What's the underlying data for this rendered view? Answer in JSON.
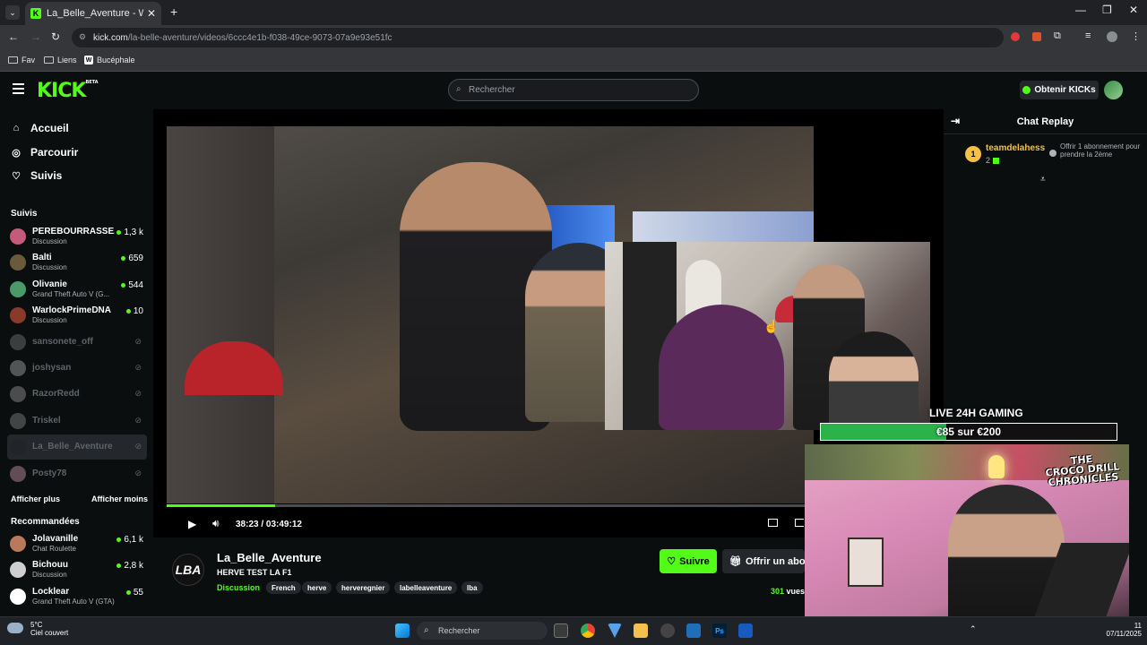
{
  "browser": {
    "tab_title": "La_Belle_Aventure - Watch the V",
    "url_host": "kick.com",
    "url_path": "/la-belle-aventure/videos/6ccc4e1b-f038-49ce-9073-07a9e93e51fc",
    "bookmarks": [
      "Fav",
      "Liens",
      "Bucéphale"
    ]
  },
  "header": {
    "logo": "KICK",
    "logo_badge": "BETA",
    "search_placeholder": "Rechercher",
    "get_kicks": "Obtenir KICKs"
  },
  "sidebar": {
    "nav": [
      {
        "label": "Accueil",
        "icon": "home-icon"
      },
      {
        "label": "Parcourir",
        "icon": "compass-icon"
      },
      {
        "label": "Suivis",
        "icon": "heart-icon"
      }
    ],
    "followed_title": "Suivis",
    "followed": [
      {
        "name": "PEREBOURRASSE...",
        "category": "Discussion",
        "viewers": "1,3 k",
        "live": true,
        "color": "#c65a7a"
      },
      {
        "name": "Balti",
        "category": "Discussion",
        "viewers": "659",
        "live": true,
        "color": "#6b5a3a"
      },
      {
        "name": "Olivanie",
        "category": "Grand Theft Auto V (G...",
        "viewers": "544",
        "live": true,
        "color": "#4a9a6a"
      },
      {
        "name": "WarlockPrimeDNA",
        "category": "Discussion",
        "viewers": "10",
        "live": true,
        "color": "#8a3a2a"
      },
      {
        "name": "sansonete_off",
        "live": false,
        "color": "#777"
      },
      {
        "name": "joshysan",
        "live": false,
        "color": "#aaa"
      },
      {
        "name": "RazorRedd",
        "live": false,
        "color": "#999"
      },
      {
        "name": "Triskel",
        "live": false,
        "color": "#888"
      },
      {
        "name": "La_Belle_Aventure",
        "live": false,
        "color": "#222",
        "selected": true
      },
      {
        "name": "Posty78",
        "live": false,
        "color": "#c9a"
      }
    ],
    "show_more": "Afficher plus",
    "show_less": "Afficher moins",
    "recommended_title": "Recommandées",
    "recommended": [
      {
        "name": "Jolavanille",
        "category": "Chat Roulette",
        "viewers": "6,1 k",
        "color": "#b87a5a"
      },
      {
        "name": "Bichouu",
        "category": "Discussion",
        "viewers": "2,8 k",
        "color": "#cfcfcf"
      },
      {
        "name": "Locklear",
        "category": "Grand Theft Auto V (GTA)",
        "viewers": "55",
        "color": "#fff"
      }
    ]
  },
  "player": {
    "current_time": "38:23",
    "separator": "/",
    "duration": "03:49:12",
    "progress": 0.167
  },
  "overlay": {
    "title": "LIVE 24H GAMING",
    "goal_current": "€85",
    "goal_mid": "sur",
    "goal_target": "€200",
    "goal_fraction": 0.425,
    "webcam_logo_line1": "THE",
    "webcam_logo_line2": "CROCO DRILL",
    "webcam_logo_line3": "CHRONICLES"
  },
  "chat": {
    "title": "Chat Replay",
    "messages": [
      {
        "rank": "1",
        "user": "teamdelahess",
        "count": "2",
        "text": "Offrir 1 abonnement pour prendre la 2ème"
      }
    ]
  },
  "channel": {
    "logo": "LBA",
    "name": "La_Belle_Aventure",
    "video_title": "HERVE TEST LA F1",
    "category": "Discussion",
    "tags": [
      "French",
      "herve",
      "herveregnier",
      "labelleaventure",
      "lba"
    ],
    "follow": "Suivre",
    "gift": "Offrir un abon",
    "views_count": "301",
    "views_label": "vues"
  },
  "taskbar": {
    "temp": "5°C",
    "weather": "Ciel couvert",
    "search": "Rechercher",
    "time": "11",
    "date": "07/11/2025"
  },
  "colors": {
    "accent": "#53fc18",
    "background": "#0b0e0f",
    "panel": "#24272c"
  }
}
